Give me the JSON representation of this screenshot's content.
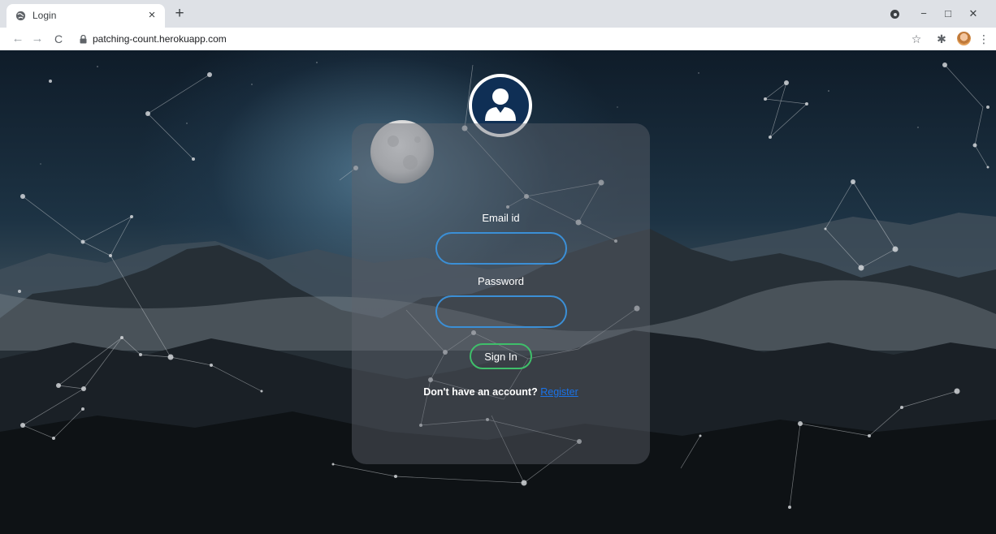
{
  "browser": {
    "tab_title": "Login",
    "tab_close": "×",
    "new_tab": "+",
    "url": "patching-count.herokuapp.com",
    "back": "←",
    "forward": "→",
    "reload": "C",
    "minimize": "−",
    "maximize": "□",
    "close": "✕",
    "star": "☆",
    "extensions": "✱",
    "menu": "⋮"
  },
  "login": {
    "email_label": "Email id",
    "email_value": "",
    "password_label": "Password",
    "password_value": "",
    "signin_label": "Sign In",
    "no_account_text": "Don't have an account?",
    "register_label": "Register"
  },
  "colors": {
    "input_border": "#3b8fd6",
    "signin_border": "#3fbf6a",
    "avatar_bg": "#0f2f55",
    "link": "#1a73e8"
  }
}
